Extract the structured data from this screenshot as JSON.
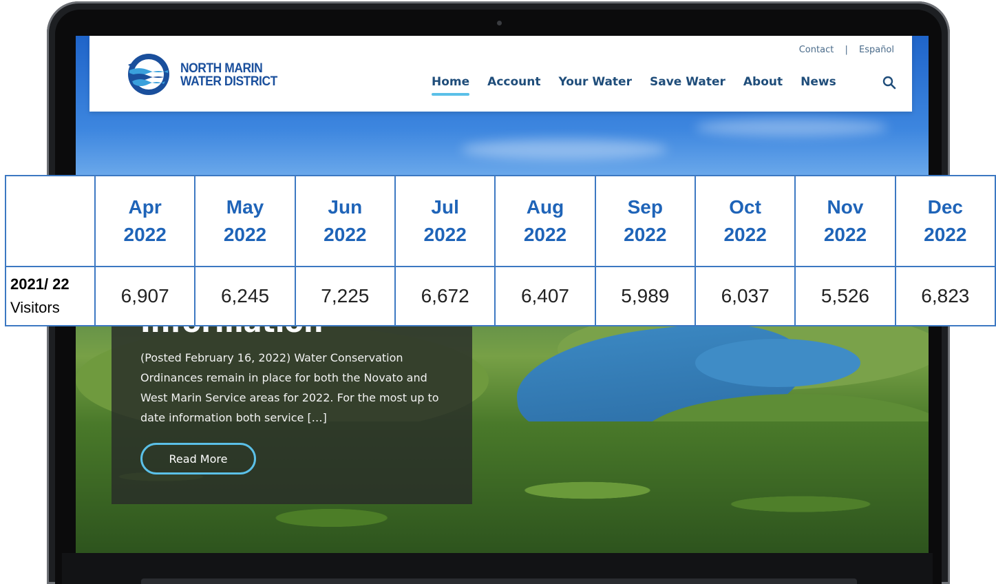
{
  "header": {
    "logo_line1": "NORTH MARIN",
    "logo_line2": "WATER DISTRICT",
    "utility_links": [
      "Contact",
      "Español"
    ],
    "utility_separator": "|",
    "nav": [
      {
        "label": "Home",
        "active": true
      },
      {
        "label": "Account",
        "active": false
      },
      {
        "label": "Your Water",
        "active": false
      },
      {
        "label": "Save Water",
        "active": false
      },
      {
        "label": "About",
        "active": false
      },
      {
        "label": "News",
        "active": false
      }
    ]
  },
  "article": {
    "title_fragment": "Information",
    "excerpt": "(Posted February 16, 2022)   Water Conservation Ordinances remain in place for both the Novato and West Marin Service areas for 2022.   For the most up to date information both service […]",
    "button_label": "Read More"
  },
  "stats_table": {
    "columns": [
      {
        "month": "Apr",
        "year": "2022"
      },
      {
        "month": "May",
        "year": "2022"
      },
      {
        "month": "Jun",
        "year": "2022"
      },
      {
        "month": "Jul",
        "year": "2022"
      },
      {
        "month": "Aug",
        "year": "2022"
      },
      {
        "month": "Sep",
        "year": "2022"
      },
      {
        "month": "Oct",
        "year": "2022"
      },
      {
        "month": "Nov",
        "year": "2022"
      },
      {
        "month": "Dec",
        "year": "2022"
      }
    ],
    "row_label_bold": "2021/ 22",
    "row_label": "Visitors",
    "values": [
      "6,907",
      "6,245",
      "7,225",
      "6,672",
      "6,407",
      "5,989",
      "6,037",
      "5,526",
      "6,823"
    ]
  },
  "colors": {
    "brand_blue": "#1a4f9c",
    "nav_text": "#1f4d7a",
    "accent_cyan": "#5bc0e8",
    "table_border": "#3c78c2",
    "table_header_text": "#1f64b8"
  },
  "icons": {
    "search": "search-icon",
    "logo": "water-waves-logo-icon"
  }
}
